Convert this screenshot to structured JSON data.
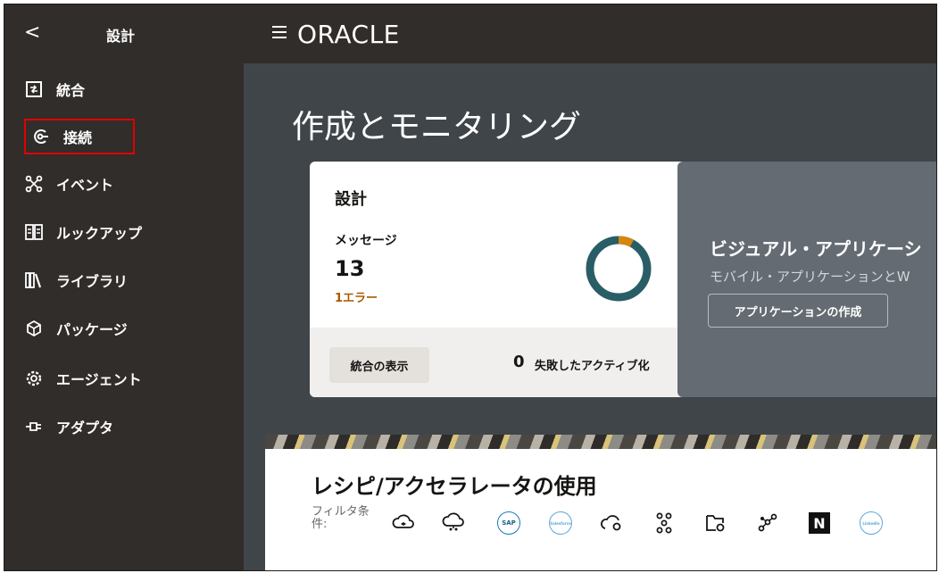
{
  "header": {
    "back_label": "<",
    "section_title": "設計",
    "brand": "ORACLE"
  },
  "sidebar": {
    "items": [
      {
        "label": "統合",
        "icon": "integration-icon"
      },
      {
        "label": "接続",
        "icon": "connection-icon",
        "highlighted": true
      },
      {
        "label": "イベント",
        "icon": "event-icon"
      },
      {
        "label": "ルックアップ",
        "icon": "lookup-icon"
      },
      {
        "label": "ライブラリ",
        "icon": "library-icon"
      },
      {
        "label": "パッケージ",
        "icon": "package-icon"
      },
      {
        "label": "エージェント",
        "icon": "agent-icon"
      },
      {
        "label": "アダプタ",
        "icon": "adapter-icon"
      }
    ]
  },
  "main": {
    "heading": "作成とモニタリング",
    "design_card": {
      "title": "設計",
      "messages_label": "メッセージ",
      "messages_count": "13",
      "error_text": "1エラー",
      "error_fraction": 0.077,
      "view_button": "統合の表示",
      "failed_count": "0",
      "failed_label": "失敗したアクティブ化"
    },
    "visual_card": {
      "title": "ビジュアル・アプリケーシ",
      "subtitle": "モバイル・アプリケーションとW",
      "button": "アプリケーションの作成"
    },
    "recipes": {
      "title": "レシピ/アクセラレータの使用",
      "filter_label": "フィルタ条件:",
      "filters": [
        "cloud-stack-icon",
        "cloud-network-icon",
        "SAP",
        "Salesforce",
        "cloud-gear-icon",
        "nodes-icon",
        "folder-gear-icon",
        "graph-icon",
        "N",
        "LinkedIn"
      ]
    }
  },
  "colors": {
    "topbar": "#312d2a",
    "main_bg": "#3f4549",
    "donut_ok": "#2a5e66",
    "donut_error": "#d5860e",
    "highlight_box": "#e00000"
  }
}
